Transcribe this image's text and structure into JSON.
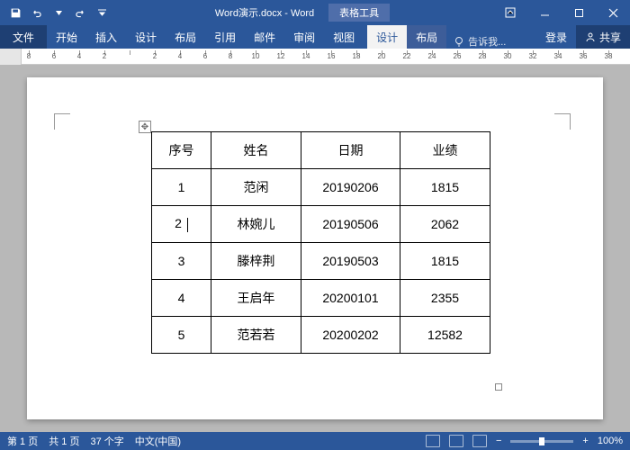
{
  "title": {
    "doc": "Word演示.docx - Word",
    "contextual": "表格工具"
  },
  "qat": {
    "save": "save",
    "undo": "undo",
    "redo": "redo",
    "custom": "custom"
  },
  "tabs": {
    "file": "文件",
    "home": "开始",
    "insert": "插入",
    "design": "设计",
    "layout": "布局",
    "references": "引用",
    "mailings": "邮件",
    "review": "审阅",
    "view": "视图",
    "tbl_design": "设计",
    "tbl_layout": "布局"
  },
  "tellme": "告诉我...",
  "signin": "登录",
  "share": "共享",
  "ruler": {
    "marks": [
      "8",
      "6",
      "4",
      "2",
      "",
      "2",
      "4",
      "6",
      "8",
      "10",
      "12",
      "14",
      "16",
      "18",
      "20",
      "22",
      "24",
      "26",
      "28",
      "30",
      "32",
      "34",
      "36",
      "38"
    ]
  },
  "table": {
    "headers": [
      "序号",
      "姓名",
      "日期",
      "业绩"
    ],
    "rows": [
      [
        "1",
        "范闲",
        "20190206",
        "1815"
      ],
      [
        "2",
        "林婉儿",
        "20190506",
        "2062"
      ],
      [
        "3",
        "滕梓荆",
        "20190503",
        "1815"
      ],
      [
        "4",
        "王启年",
        "20200101",
        "2355"
      ],
      [
        "5",
        "范若若",
        "20200202",
        "12582"
      ]
    ]
  },
  "status": {
    "page": "第 1 页",
    "pages": "共 1 页",
    "words": "37 个字",
    "lang": "中文(中国)",
    "zoom": "100%"
  }
}
